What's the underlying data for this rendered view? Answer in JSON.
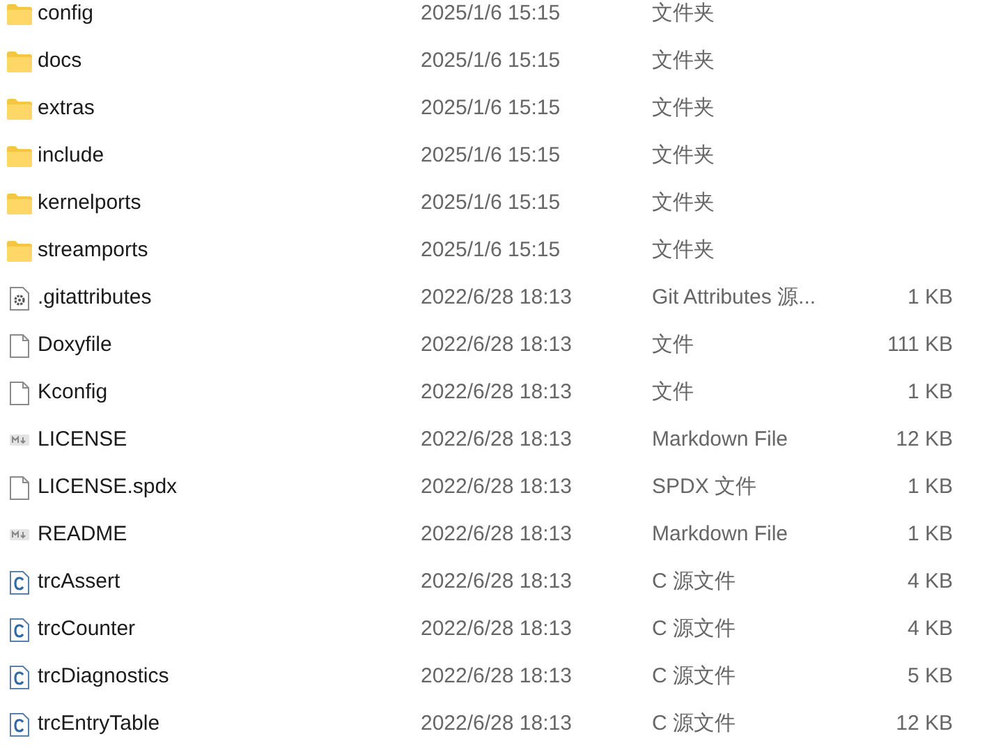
{
  "files": [
    {
      "kind": "folder",
      "name": "config",
      "modified": "2025/1/6 15:15",
      "type": "文件夹"
    },
    {
      "kind": "folder",
      "name": "docs",
      "modified": "2025/1/6 15:15",
      "type": "文件夹"
    },
    {
      "kind": "folder",
      "name": "extras",
      "modified": "2025/1/6 15:15",
      "type": "文件夹"
    },
    {
      "kind": "folder",
      "name": "include",
      "modified": "2025/1/6 15:15",
      "type": "文件夹"
    },
    {
      "kind": "folder",
      "name": "kernelports",
      "modified": "2025/1/6 15:15",
      "type": "文件夹"
    },
    {
      "kind": "folder",
      "name": "streamports",
      "modified": "2025/1/6 15:15",
      "type": "文件夹"
    },
    {
      "kind": "settings",
      "name": ".gitattributes",
      "modified": "2022/6/28 18:13",
      "type": "Git Attributes 源...",
      "size": "1 KB"
    },
    {
      "kind": "file",
      "name": "Doxyfile",
      "modified": "2022/6/28 18:13",
      "type": "文件",
      "size": "111 KB"
    },
    {
      "kind": "file",
      "name": "Kconfig",
      "modified": "2022/6/28 18:13",
      "type": "文件",
      "size": "1 KB"
    },
    {
      "kind": "markdown",
      "name": "LICENSE",
      "modified": "2022/6/28 18:13",
      "type": "Markdown File",
      "size": "12 KB"
    },
    {
      "kind": "file",
      "name": "LICENSE.spdx",
      "modified": "2022/6/28 18:13",
      "type": "SPDX 文件",
      "size": "1 KB"
    },
    {
      "kind": "markdown",
      "name": "README",
      "modified": "2022/6/28 18:13",
      "type": "Markdown File",
      "size": "1 KB"
    },
    {
      "kind": "c",
      "name": "trcAssert",
      "modified": "2022/6/28 18:13",
      "type": "C 源文件",
      "size": "4 KB"
    },
    {
      "kind": "c",
      "name": "trcCounter",
      "modified": "2022/6/28 18:13",
      "type": "C 源文件",
      "size": "4 KB"
    },
    {
      "kind": "c",
      "name": "trcDiagnostics",
      "modified": "2022/6/28 18:13",
      "type": "C 源文件",
      "size": "5 KB"
    },
    {
      "kind": "c",
      "name": "trcEntryTable",
      "modified": "2022/6/28 18:13",
      "type": "C 源文件",
      "size": "12 KB"
    }
  ]
}
